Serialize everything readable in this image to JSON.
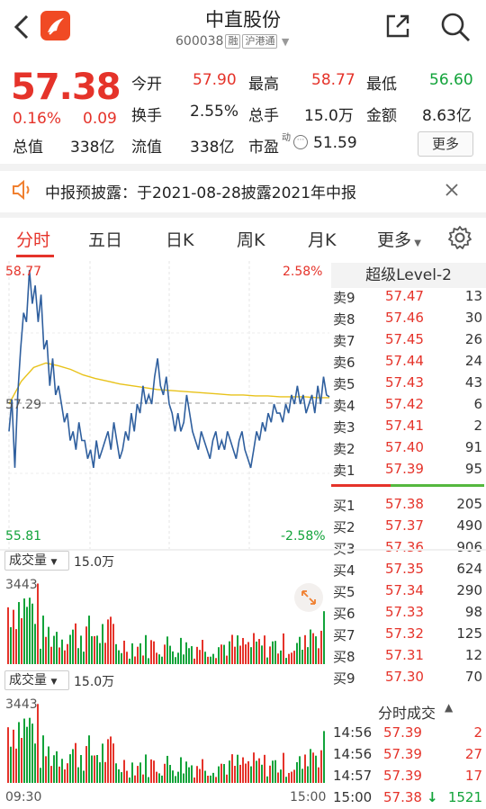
{
  "header": {
    "title": "中直股份",
    "code": "600038",
    "tag_rong": "融",
    "tag_hgt": "沪港通"
  },
  "quote": {
    "price": "57.38",
    "change_pct": "0.16%",
    "change": "0.09",
    "fields": [
      {
        "label": "今开",
        "value": "57.90",
        "color": "red"
      },
      {
        "label": "最高",
        "value": "58.77",
        "color": "red"
      },
      {
        "label": "最低",
        "value": "56.60",
        "color": "green"
      },
      {
        "label": "换手",
        "value": "2.55%",
        "color": "dark"
      },
      {
        "label": "总手",
        "value": "15.0万",
        "color": "dark"
      },
      {
        "label": "金额",
        "value": "8.63亿",
        "color": "dark"
      },
      {
        "label": "总值",
        "value": "338亿",
        "color": "dark"
      },
      {
        "label": "流值",
        "value": "338亿",
        "color": "dark"
      },
      {
        "label": "市盈",
        "value": "51.59",
        "color": "dark"
      }
    ],
    "pe_superscript": "动",
    "more_label": "更多"
  },
  "notice": {
    "text": "中报预披露：于2021-08-28披露2021年中报"
  },
  "tabs": [
    "分时",
    "五日",
    "日K",
    "周K",
    "月K",
    "更多"
  ],
  "chart": {
    "top_left": "58.77",
    "top_right": "2.58%",
    "mid_left": "57.29",
    "bottom_left": "55.81",
    "bottom_right": "-2.58%",
    "x_start": "09:30",
    "x_end": "15:00"
  },
  "chart_data": {
    "type": "line",
    "series": [],
    "x_range": [
      "09:30",
      "15:00"
    ],
    "ylim": [
      55.81,
      58.77
    ],
    "reference": 57.29,
    "price_points": [
      57.0,
      57.35,
      56.6,
      57.4,
      57.9,
      58.3,
      58.2,
      58.77,
      58.4,
      58.6,
      58.2,
      58.5,
      57.9,
      58.0,
      57.5,
      57.8,
      57.4,
      57.5,
      57.3,
      57.1,
      57.2,
      56.9,
      57.0,
      56.8,
      57.1,
      56.9,
      56.9,
      56.7,
      56.8,
      56.6,
      56.9,
      56.7,
      56.8,
      56.9,
      57.0,
      56.8,
      57.1,
      56.9,
      56.7,
      56.8,
      57.0,
      56.9,
      57.2,
      57.0,
      57.3,
      57.2,
      57.5,
      57.3,
      57.4,
      57.3,
      57.6,
      57.8,
      57.5,
      57.4,
      57.6,
      57.3,
      57.2,
      57.0,
      57.2,
      57.0,
      57.1,
      57.4,
      57.2,
      57.0,
      56.9,
      56.8,
      57.0,
      56.9,
      56.8,
      56.7,
      56.9,
      57.0,
      56.8,
      56.9,
      56.8,
      57.0,
      56.9,
      56.8,
      56.7,
      56.9,
      57.0,
      56.8,
      56.7,
      56.6,
      56.8,
      57.0,
      56.9,
      57.1,
      57.0,
      57.2,
      57.1,
      57.3,
      57.2,
      57.2,
      57.1,
      57.3,
      57.2,
      57.4,
      57.3,
      57.5,
      57.3,
      57.4,
      57.2,
      57.3,
      57.4,
      57.2,
      57.5,
      57.3,
      57.6,
      57.4,
      57.38
    ],
    "avg_points": [
      57.3,
      57.55,
      57.7,
      57.75,
      57.72,
      57.68,
      57.62,
      57.58,
      57.55,
      57.52,
      57.5,
      57.48,
      57.46,
      57.45,
      57.44,
      57.43,
      57.42,
      57.41,
      57.4,
      57.4,
      57.39,
      57.39,
      57.38,
      57.38,
      57.38,
      57.37,
      57.37
    ]
  },
  "orderbook": {
    "title": "超级Level-2",
    "asks": [
      {
        "name": "卖9",
        "price": "57.47",
        "vol": "13"
      },
      {
        "name": "卖8",
        "price": "57.46",
        "vol": "30"
      },
      {
        "name": "卖7",
        "price": "57.45",
        "vol": "26"
      },
      {
        "name": "卖6",
        "price": "57.44",
        "vol": "24"
      },
      {
        "name": "卖5",
        "price": "57.43",
        "vol": "43"
      },
      {
        "name": "卖4",
        "price": "57.42",
        "vol": "6"
      },
      {
        "name": "卖3",
        "price": "57.41",
        "vol": "2"
      },
      {
        "name": "卖2",
        "price": "57.40",
        "vol": "91"
      },
      {
        "name": "卖1",
        "price": "57.39",
        "vol": "95"
      }
    ],
    "bids": [
      {
        "name": "买1",
        "price": "57.38",
        "vol": "205"
      },
      {
        "name": "买2",
        "price": "57.37",
        "vol": "490"
      },
      {
        "name": "买3",
        "price": "57.36",
        "vol": "906"
      },
      {
        "name": "买4",
        "price": "57.35",
        "vol": "624"
      },
      {
        "name": "买5",
        "price": "57.34",
        "vol": "290"
      },
      {
        "name": "买6",
        "price": "57.33",
        "vol": "98"
      },
      {
        "name": "买7",
        "price": "57.32",
        "vol": "125"
      },
      {
        "name": "买8",
        "price": "57.31",
        "vol": "12"
      },
      {
        "name": "买9",
        "price": "57.30",
        "vol": "70"
      }
    ]
  },
  "trades": {
    "title": "分时成交",
    "rows": [
      {
        "time": "14:56",
        "price": "57.39",
        "vol": "2",
        "dir": ""
      },
      {
        "time": "14:56",
        "price": "57.39",
        "vol": "27",
        "dir": ""
      },
      {
        "time": "14:57",
        "price": "57.39",
        "vol": "17",
        "dir": ""
      },
      {
        "time": "15:00",
        "price": "57.38",
        "vol": "1521",
        "dir": "↓"
      }
    ]
  },
  "volume": {
    "label": "成交量",
    "total": "15.0万",
    "max": "3443"
  },
  "colors": {
    "up": "#e5332a",
    "down": "#12a33a",
    "line": "#2f5f9e",
    "avg": "#e8c21a"
  }
}
